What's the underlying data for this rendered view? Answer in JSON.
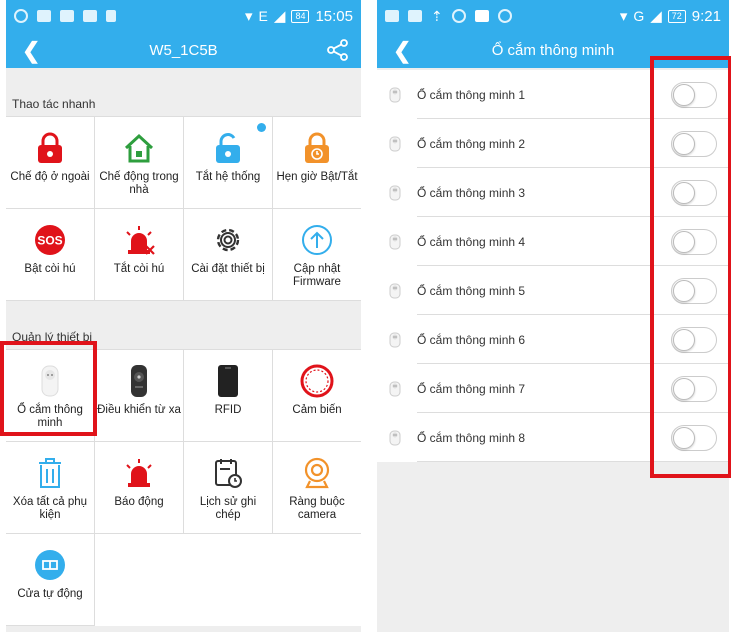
{
  "left": {
    "status": {
      "time": "15:05",
      "battery": "84",
      "network": "E"
    },
    "appbar": {
      "title": "W5_1C5B"
    },
    "quick": {
      "label": "Thao tác nhanh",
      "items": [
        {
          "label": "Chế độ ở ngoài",
          "icon": "lock-away-icon"
        },
        {
          "label": "Chế động trong nhà",
          "icon": "home-icon"
        },
        {
          "label": "Tắt hệ thống",
          "icon": "unlock-icon"
        },
        {
          "label": "Hẹn giờ Bật/Tắt",
          "icon": "timer-lock-icon"
        },
        {
          "label": "Bật còi hú",
          "icon": "sos-icon"
        },
        {
          "label": "Tắt còi hú",
          "icon": "siren-off-icon"
        },
        {
          "label": "Cài đặt thiết bị",
          "icon": "gear-icon"
        },
        {
          "label": "Cập nhật Firmware",
          "icon": "upload-icon"
        }
      ]
    },
    "devices": {
      "label": "Quản lý thiết bị",
      "items": [
        {
          "label": "Ổ cắm thông minh",
          "icon": "smart-plug-icon"
        },
        {
          "label": "Điều khiển từ xa",
          "icon": "remote-icon"
        },
        {
          "label": "RFID",
          "icon": "rfid-icon"
        },
        {
          "label": "Cảm biến",
          "icon": "sensor-icon"
        },
        {
          "label": "Xóa tất cả phụ kiện",
          "icon": "trash-icon"
        },
        {
          "label": "Báo động",
          "icon": "alarm-icon"
        },
        {
          "label": "Lịch sử ghi chép",
          "icon": "history-icon"
        },
        {
          "label": "Ràng buộc camera",
          "icon": "camera-icon"
        },
        {
          "label": "Cửa tự động",
          "icon": "door-icon"
        }
      ]
    }
  },
  "right": {
    "status": {
      "time": "9:21",
      "battery": "72",
      "network": "G"
    },
    "appbar": {
      "title": "Ổ cắm thông minh"
    },
    "plugs": [
      {
        "label": "Ổ cắm thông minh 1",
        "on": false
      },
      {
        "label": "Ổ cắm thông minh 2",
        "on": false
      },
      {
        "label": "Ổ cắm thông minh 3",
        "on": false
      },
      {
        "label": "Ổ cắm thông minh 4",
        "on": false
      },
      {
        "label": "Ổ cắm thông minh 5",
        "on": false
      },
      {
        "label": "Ổ cắm thông minh 6",
        "on": false
      },
      {
        "label": "Ổ cắm thông minh 7",
        "on": false
      },
      {
        "label": "Ổ cắm thông minh 8",
        "on": false
      }
    ]
  },
  "colors": {
    "accent": "#33aeec",
    "highlight": "#e0131a",
    "icon_red": "#e0131a",
    "icon_green": "#2e9e3e",
    "icon_orange": "#f2922a"
  }
}
